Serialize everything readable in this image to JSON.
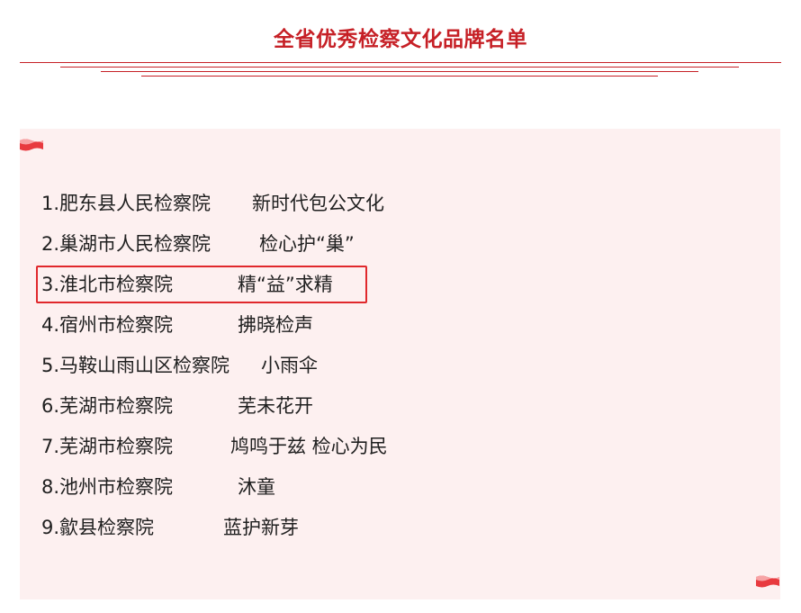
{
  "title": "全省优秀检察文化品牌名单",
  "colors": {
    "accent": "#c62026",
    "panel_background": "#fdf0f0",
    "highlight_border": "#e0282c"
  },
  "list": [
    {
      "org": "1.肥东县人民检察院",
      "brand": "新时代包公文化"
    },
    {
      "org": "2.巢湖市人民检察院",
      "brand": "检心护“巢”"
    },
    {
      "org": "3.淮北市检察院",
      "brand": "精“益”求精"
    },
    {
      "org": "4.宿州市检察院",
      "brand": "拂晓检声"
    },
    {
      "org": "5.马鞍山雨山区检察院",
      "brand": "小雨伞"
    },
    {
      "org": "6.芜湖市检察院",
      "brand": "芜未花开"
    },
    {
      "org": "7.芜湖市检察院",
      "brand": "鸠鸣于兹 检心为民"
    },
    {
      "org": "8.池州市检察院",
      "brand": "沐童"
    },
    {
      "org": "9.歙县检察院",
      "brand": "蓝护新芽"
    }
  ]
}
